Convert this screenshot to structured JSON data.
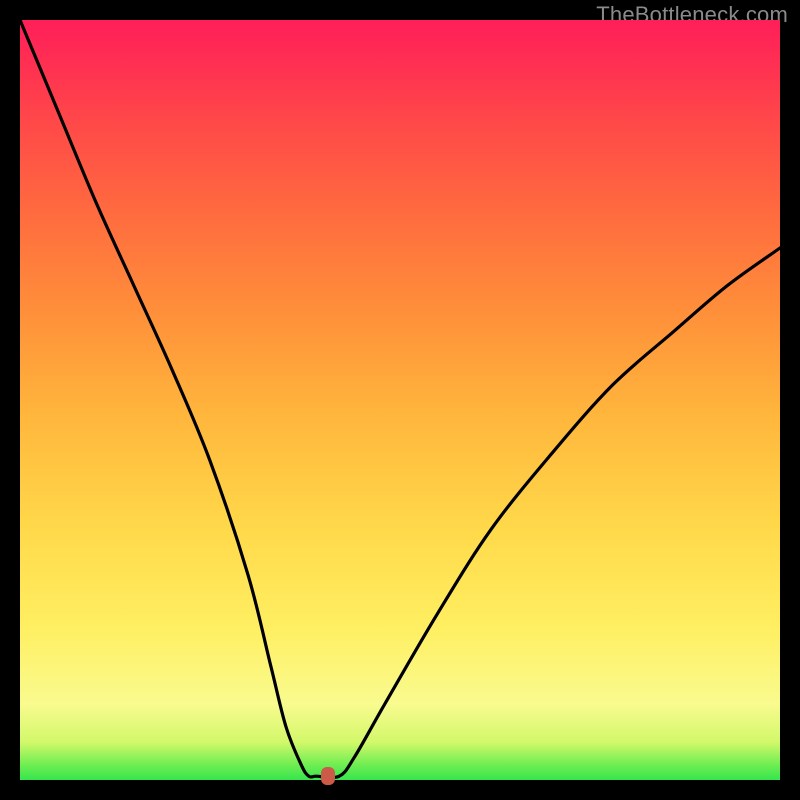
{
  "watermark": "TheBottleneck.com",
  "chart_data": {
    "type": "line",
    "title": "",
    "xlabel": "",
    "ylabel": "",
    "xlim": [
      0,
      100
    ],
    "ylim": [
      0,
      100
    ],
    "x": [
      0,
      5,
      10,
      15,
      20,
      25,
      30,
      33,
      35,
      37,
      38,
      39,
      42,
      44,
      48,
      55,
      62,
      70,
      78,
      86,
      93,
      100
    ],
    "values": [
      100,
      88,
      76,
      65,
      54,
      42,
      27,
      15,
      7,
      2,
      0.5,
      0.5,
      0.5,
      3,
      10,
      22,
      33,
      43,
      52,
      59,
      65,
      70
    ],
    "marker": {
      "x": 40.5,
      "y": 0.5
    },
    "background_gradient": {
      "direction": "bottom-to-top",
      "stops": [
        {
          "pos": 0,
          "color": "#36e54d"
        },
        {
          "pos": 2,
          "color": "#6fee52"
        },
        {
          "pos": 5,
          "color": "#d3f86a"
        },
        {
          "pos": 10,
          "color": "#f9fb8f"
        },
        {
          "pos": 20,
          "color": "#ffef62"
        },
        {
          "pos": 33,
          "color": "#ffd94a"
        },
        {
          "pos": 48,
          "color": "#ffb63c"
        },
        {
          "pos": 62,
          "color": "#ff8e3a"
        },
        {
          "pos": 75,
          "color": "#ff6a3f"
        },
        {
          "pos": 86,
          "color": "#ff4a48"
        },
        {
          "pos": 95,
          "color": "#ff2d53"
        },
        {
          "pos": 100,
          "color": "#ff1f59"
        }
      ]
    }
  }
}
